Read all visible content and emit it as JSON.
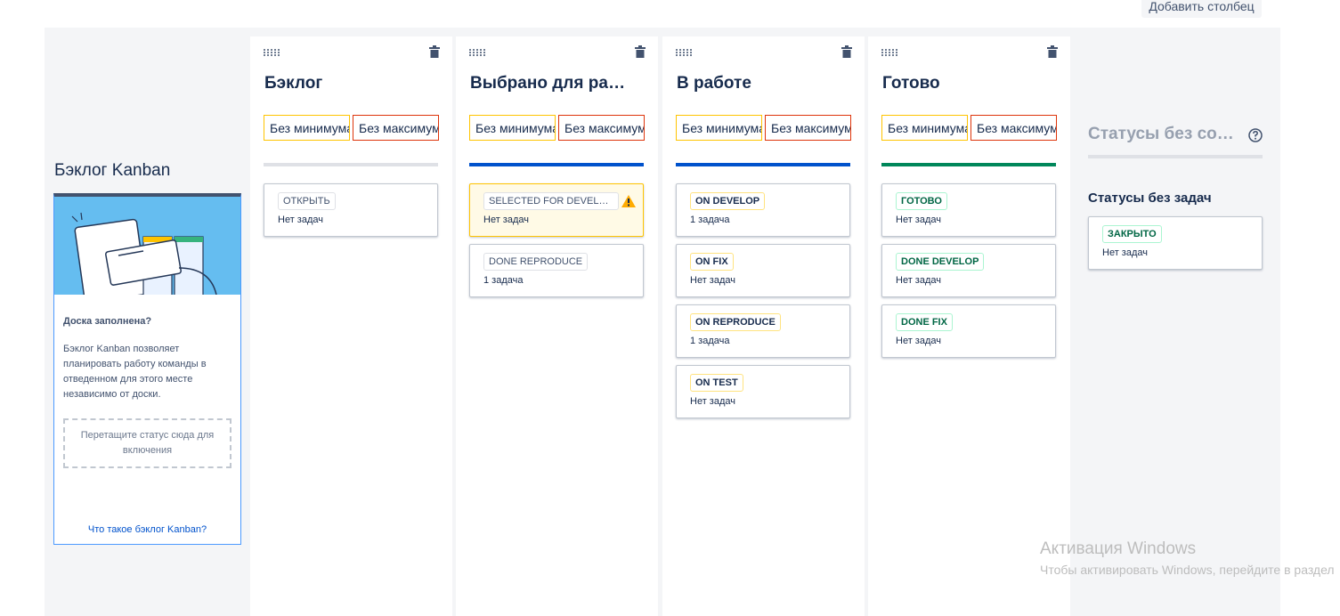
{
  "toolbar": {
    "add_column_label": "Добавить столбец"
  },
  "kanban_backlog": {
    "title": "Бэклог Kanban",
    "heading": "Доска заполнена?",
    "description": "Бэклог Kanban позволяет планировать работу команды в отведенном для этого месте независимо от доски.",
    "dropzone": "Перетащите статус сюда для включения",
    "link": "Что такое бэклог Kanban?"
  },
  "columns": [
    {
      "title": "Бэклог",
      "min_placeholder": "Без минимума",
      "max_placeholder": "Без максимума",
      "bar_color": "#dfe1e6",
      "statuses": [
        {
          "label": "ОТКРЫТЬ",
          "count": "Нет задач",
          "color": "gray"
        }
      ]
    },
    {
      "title": "Выбрано для разработки",
      "min_placeholder": "Без минимума",
      "max_placeholder": "Без максимума",
      "bar_color": "#0052cc",
      "statuses": [
        {
          "label": "SELECTED FOR DEVELOPMENT",
          "count": "Нет задач",
          "color": "gray",
          "warning": true
        },
        {
          "label": "DONE REPRODUCE",
          "count": "1 задача",
          "color": "gray"
        }
      ]
    },
    {
      "title": "В работе",
      "min_placeholder": "Без минимума",
      "max_placeholder": "Без максимума",
      "bar_color": "#0052cc",
      "statuses": [
        {
          "label": "ON DEVELOP",
          "count": "1 задача",
          "color": "yellow"
        },
        {
          "label": "ON FIX",
          "count": "Нет задач",
          "color": "yellow"
        },
        {
          "label": "ON REPRODUCE",
          "count": "1 задача",
          "color": "yellow"
        },
        {
          "label": "ON TEST",
          "count": "Нет задач",
          "color": "yellow"
        }
      ]
    },
    {
      "title": "Готово",
      "min_placeholder": "Без минимума",
      "max_placeholder": "Без максимума",
      "bar_color": "#00875a",
      "statuses": [
        {
          "label": "ГОТОВО",
          "count": "Нет задач",
          "color": "green"
        },
        {
          "label": "DONE DEVELOP",
          "count": "Нет задач",
          "color": "green"
        },
        {
          "label": "DONE FIX",
          "count": "Нет задач",
          "color": "green"
        }
      ]
    }
  ],
  "unmapped": {
    "title": "Статусы без сопоставления",
    "subtitle": "Статусы без задач",
    "statuses": [
      {
        "label": "ЗАКРЫТО",
        "count": "Нет задач",
        "color": "green"
      }
    ]
  },
  "watermark": {
    "title": "Активация Windows",
    "subtitle": "Чтобы активировать Windows, перейдите в раздел"
  },
  "icons": {
    "drag": "drag-handle-icon",
    "trash": "trash-icon",
    "warning": "warning-icon",
    "help": "help-icon"
  }
}
